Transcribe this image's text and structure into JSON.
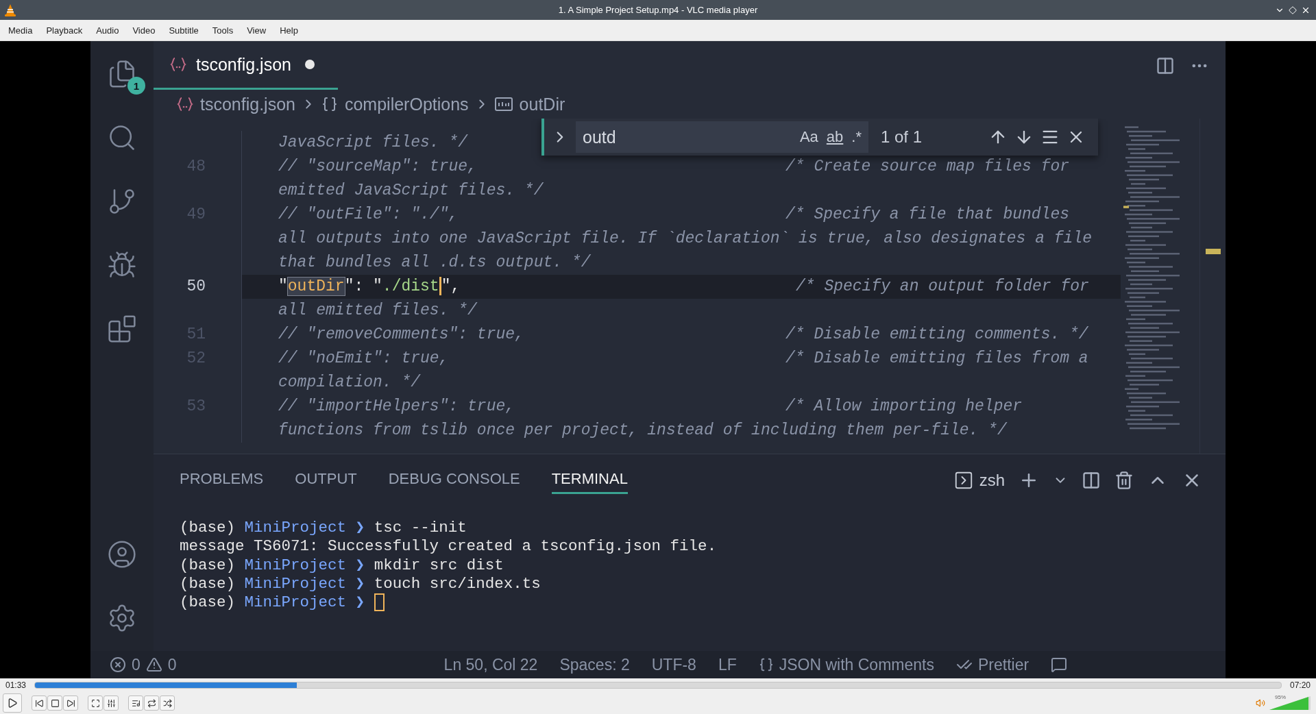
{
  "window": {
    "title": "1. A Simple Project Setup.mp4 - VLC media player"
  },
  "menu": [
    "Media",
    "Playback",
    "Audio",
    "Video",
    "Subtitle",
    "Tools",
    "View",
    "Help"
  ],
  "vscode": {
    "activity_bar": {
      "top": [
        {
          "kind": "files",
          "badge": "1"
        },
        {
          "kind": "search"
        },
        {
          "kind": "source-control"
        },
        {
          "kind": "run"
        },
        {
          "kind": "extensions"
        }
      ],
      "bottom": [
        {
          "kind": "account"
        },
        {
          "kind": "settings"
        }
      ]
    },
    "tabs": [
      {
        "label": "tsconfig.json",
        "modified": true,
        "selected": true
      }
    ],
    "breadcrumbs": [
      {
        "kind": "file",
        "label": "tsconfig.json"
      },
      {
        "kind": "object",
        "label": "compilerOptions"
      },
      {
        "kind": "string",
        "label": "outDir"
      }
    ],
    "find": {
      "value": "outd",
      "options": [
        "Aa",
        "ab",
        ".*"
      ],
      "result": "1 of 1"
    },
    "lines": [
      {
        "kind": "comment",
        "current": false,
        "code": "JavaScript files. */"
      },
      {
        "kind": "comment",
        "current": false,
        "number": "48",
        "code": "// \"sourceMap\": true,",
        "comment": "/* Create source map files for"
      },
      {
        "kind": "comment",
        "current": false,
        "code": "emitted JavaScript files. */"
      },
      {
        "kind": "comment",
        "current": false,
        "number": "49",
        "code": "// \"outFile\": \"./\",",
        "comment": "/* Specify a file that bundles"
      },
      {
        "kind": "comment",
        "current": false,
        "code": "all outputs into one JavaScript file. If `declaration` is true, also designates a file"
      },
      {
        "kind": "comment",
        "current": false,
        "code": "that bundles all .d.ts output. */"
      },
      {
        "kind": "property",
        "number": "50",
        "current": true,
        "segments": [
          {
            "kind": "punct",
            "text": "\""
          },
          {
            "kind": "match",
            "text": "outDir"
          },
          {
            "kind": "punct",
            "text": "\": \""
          },
          {
            "kind": "string",
            "text": "./dist"
          },
          {
            "kind": "cursor"
          },
          {
            "kind": "punct",
            "text": "\","
          }
        ],
        "comment": "/* Specify an output folder for"
      },
      {
        "kind": "comment",
        "current": false,
        "code": "all emitted files. */"
      },
      {
        "kind": "comment",
        "current": false,
        "number": "51",
        "code": "// \"removeComments\": true,",
        "comment": "/* Disable emitting comments. */"
      },
      {
        "kind": "comment",
        "current": false,
        "number": "52",
        "code": "// \"noEmit\": true,",
        "comment": "/* Disable emitting files from a"
      },
      {
        "kind": "comment",
        "current": false,
        "code": "compilation. */"
      },
      {
        "kind": "comment",
        "current": false,
        "number": "53",
        "code": "// \"importHelpers\": true,",
        "comment": "/* Allow importing helper"
      },
      {
        "kind": "comment",
        "current": false,
        "code": "functions from tslib once per project, instead of including them per-file. */"
      }
    ],
    "panel": {
      "tabs": [
        {
          "label": "PROBLEMS",
          "selected": false
        },
        {
          "label": "OUTPUT",
          "selected": false
        },
        {
          "label": "DEBUG CONSOLE",
          "selected": false
        },
        {
          "label": "TERMINAL",
          "selected": true
        }
      ],
      "shell": "zsh",
      "terminal": [
        {
          "kind": "prompt",
          "env": "(base)",
          "dir": "MiniProject",
          "arrow": "❯",
          "command": "tsc --init",
          "cursor": false
        },
        {
          "kind": "output",
          "text": "message TS6071: Successfully created a tsconfig.json file."
        },
        {
          "kind": "prompt",
          "env": "(base)",
          "dir": "MiniProject",
          "arrow": "❯",
          "command": "mkdir src dist",
          "cursor": false
        },
        {
          "kind": "prompt",
          "env": "(base)",
          "dir": "MiniProject",
          "arrow": "❯",
          "command": "touch src/index.ts",
          "cursor": false
        },
        {
          "kind": "prompt",
          "env": "(base)",
          "dir": "MiniProject",
          "arrow": "❯",
          "cursor": true
        }
      ]
    },
    "status_bar": {
      "errors": "0",
      "warnings": "0",
      "items": [
        {
          "kind": "text",
          "label": "Ln 50, Col 22"
        },
        {
          "kind": "text",
          "label": "Spaces: 2"
        },
        {
          "kind": "text",
          "label": "UTF-8"
        },
        {
          "kind": "text",
          "label": "LF"
        },
        {
          "kind": "language",
          "label": "JSON with Comments"
        },
        {
          "kind": "formatter",
          "label": "Prettier"
        },
        {
          "kind": "feedback"
        }
      ]
    }
  },
  "player": {
    "elapsed": "01:33",
    "total": "07:20",
    "progress": {
      "level": 0.21
    },
    "controls": [
      [
        {
          "kind": "play"
        }
      ],
      [
        {
          "kind": "previous"
        },
        {
          "kind": "stop"
        },
        {
          "kind": "next"
        }
      ],
      [
        {
          "kind": "fullscreen"
        },
        {
          "kind": "extended"
        }
      ],
      [
        {
          "kind": "playlist"
        },
        {
          "kind": "loop"
        },
        {
          "kind": "random"
        }
      ]
    ],
    "volume": {
      "level": 0.95,
      "reading": "95%"
    }
  }
}
